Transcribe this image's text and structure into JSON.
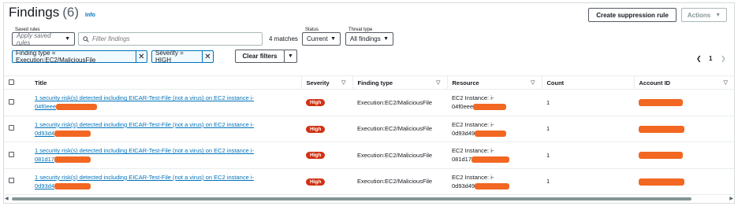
{
  "header": {
    "title": "Findings",
    "count": "(6)",
    "info": "Info",
    "create_button": "Create suppression rule",
    "actions_button": "Actions"
  },
  "filters": {
    "saved_rules_label": "Saved rules",
    "saved_rules_value": "Apply saved rules",
    "search_placeholder": "Filter findings",
    "matches": "4 matches",
    "status_label": "Status",
    "status_value": "Current",
    "threat_label": "Threat type",
    "threat_value": "All findings",
    "tokens": [
      "Finding type = Execution:EC2/MaliciousFile",
      "Severity = HIGH"
    ],
    "clear_button": "Clear filters"
  },
  "pagination": {
    "page": "1"
  },
  "table": {
    "columns": [
      "Title",
      "Severity",
      "Finding type",
      "Resource",
      "Count",
      "Account ID"
    ],
    "rows": [
      {
        "title_line1": "1 security risk(s) detected including EICAR-Test-File (not a virus) on EC2 instance i-",
        "title_line2": "04f0eee",
        "severity": "High",
        "finding_type": "Execution:EC2/MaliciousFile",
        "resource_line1": "EC2 Instance: i-",
        "resource_line2": "04f0eee",
        "count": "1"
      },
      {
        "title_line1": "1 security risk(s) detected including EICAR-Test-File (not a virus) on EC2 instance i-",
        "title_line2": "0d93d4",
        "severity": "High",
        "finding_type": "Execution:EC2/MaliciousFile",
        "resource_line1": "EC2 Instance: i-",
        "resource_line2": "0d93d49",
        "count": "1"
      },
      {
        "title_line1": "1 security risk(s) detected including EICAR-Test-File (not a virus) on EC2 instance i-",
        "title_line2": "081d17",
        "severity": "High",
        "finding_type": "Execution:EC2/MaliciousFile",
        "resource_line1": "EC2 Instance: i-",
        "resource_line2": "081d17",
        "count": "1"
      },
      {
        "title_line1": "1 security risk(s) detected including EICAR-Test-File (not a virus) on EC2 instance i-",
        "title_line2": "0d93d4",
        "severity": "High",
        "finding_type": "Execution:EC2/MaliciousFile",
        "resource_line1": "EC2 Instance: i-",
        "resource_line2": "0d93d49",
        "count": "1"
      }
    ]
  },
  "colors": {
    "severity_high": "#d13212",
    "link": "#0073bb",
    "redaction": "#f26722"
  }
}
